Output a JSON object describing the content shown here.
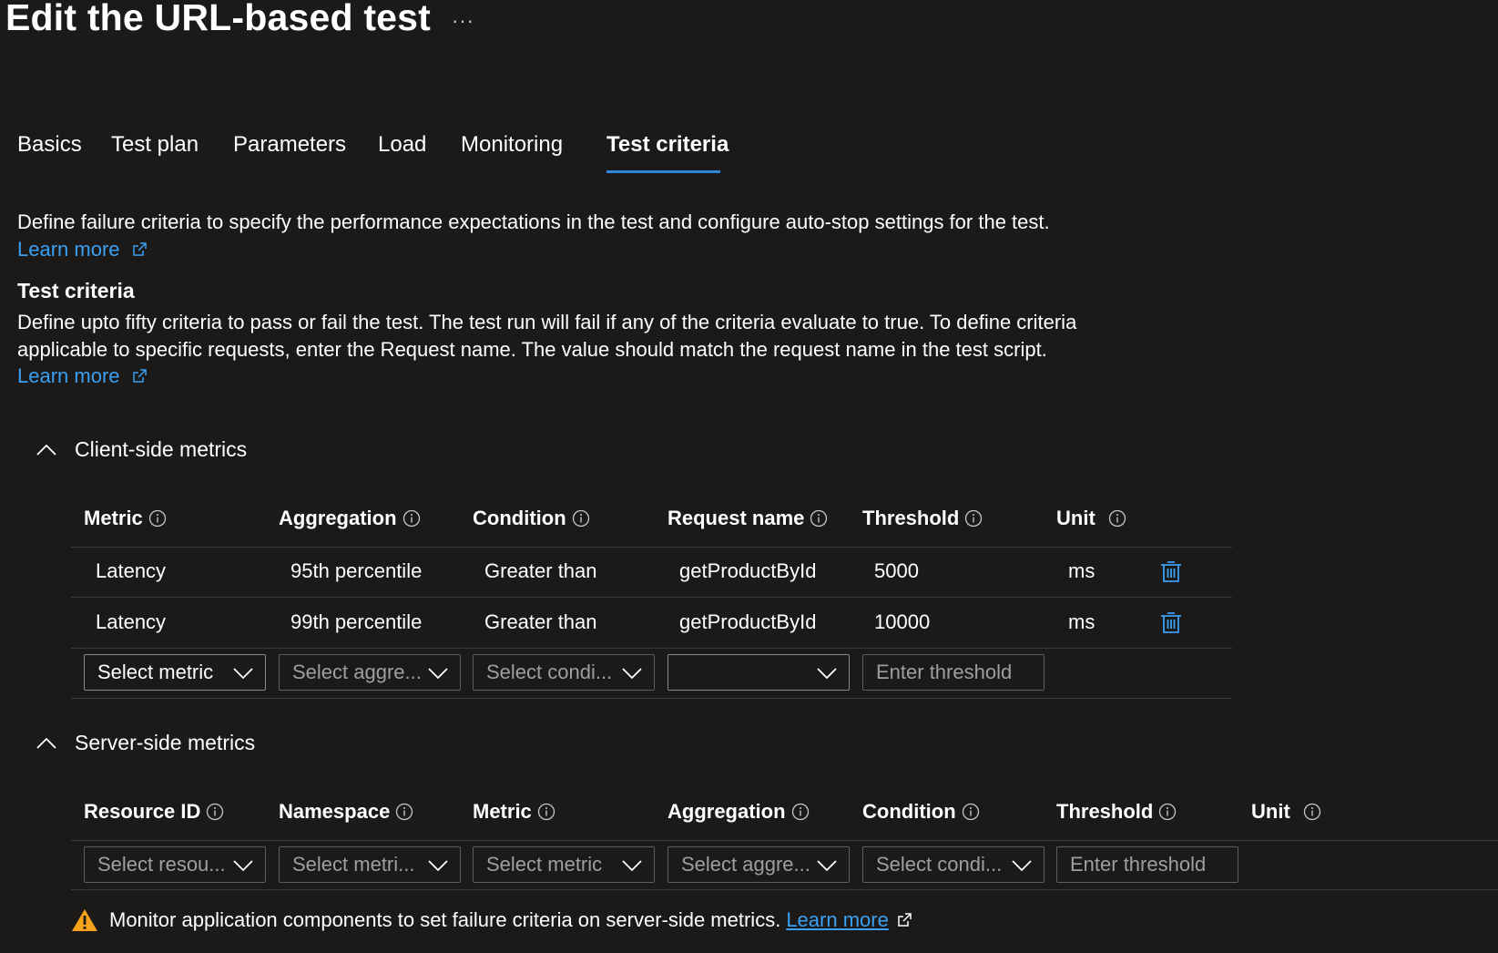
{
  "header": {
    "title": "Edit the URL-based test",
    "more_label": "···"
  },
  "tabs": [
    {
      "label": "Basics",
      "active": false
    },
    {
      "label": "Test plan",
      "active": false
    },
    {
      "label": "Parameters",
      "active": false
    },
    {
      "label": "Load",
      "active": false
    },
    {
      "label": "Monitoring",
      "active": false
    },
    {
      "label": "Test criteria",
      "active": true
    }
  ],
  "intro": {
    "text": "Define failure criteria to specify the performance expectations in the test and configure auto-stop settings for the test.",
    "learn_more": "Learn more"
  },
  "test_criteria": {
    "heading": "Test criteria",
    "line1": "Define upto fifty criteria to pass or fail the test. The test run will fail if any of the criteria evaluate to true. To define criteria",
    "line2": "applicable to specific requests, enter the Request name. The value should match the request name in the test script.",
    "learn_more": "Learn more"
  },
  "client_metrics": {
    "label": "Client-side metrics",
    "columns": [
      "Metric",
      "Aggregation",
      "Condition",
      "Request name",
      "Threshold",
      "Unit"
    ],
    "rows": [
      {
        "metric": "Latency",
        "aggregation": "95th percentile",
        "condition": "Greater than",
        "request_name": "getProductById",
        "threshold": "5000",
        "unit": "ms"
      },
      {
        "metric": "Latency",
        "aggregation": "99th percentile",
        "condition": "Greater than",
        "request_name": "getProductById",
        "threshold": "10000",
        "unit": "ms"
      }
    ],
    "new_row": {
      "metric": "Select metric",
      "aggregation": "Select aggre...",
      "condition": "Select condi...",
      "request_name": "",
      "threshold_placeholder": "Enter threshold"
    }
  },
  "server_metrics": {
    "label": "Server-side metrics",
    "columns": [
      "Resource ID",
      "Namespace",
      "Metric",
      "Aggregation",
      "Condition",
      "Threshold",
      "Unit"
    ],
    "new_row": {
      "resource_id": "Select resou...",
      "namespace": "Select metri...",
      "metric": "Select metric",
      "aggregation": "Select aggre...",
      "condition": "Select condi...",
      "threshold_placeholder": "Enter threshold"
    }
  },
  "warning": {
    "text": "Monitor application components to set failure criteria on server-side metrics.",
    "learn_more": "Learn more"
  },
  "colors": {
    "background": "#1b1a19",
    "accent": "#2b88d8",
    "link": "#3aa0f3",
    "warning": "#f7a21b",
    "divider": "#3b3a39"
  },
  "icons": [
    "more-icon",
    "external-link-icon",
    "chevron-up-icon",
    "info-icon",
    "delete-icon",
    "chevron-down-icon",
    "warning-icon"
  ]
}
